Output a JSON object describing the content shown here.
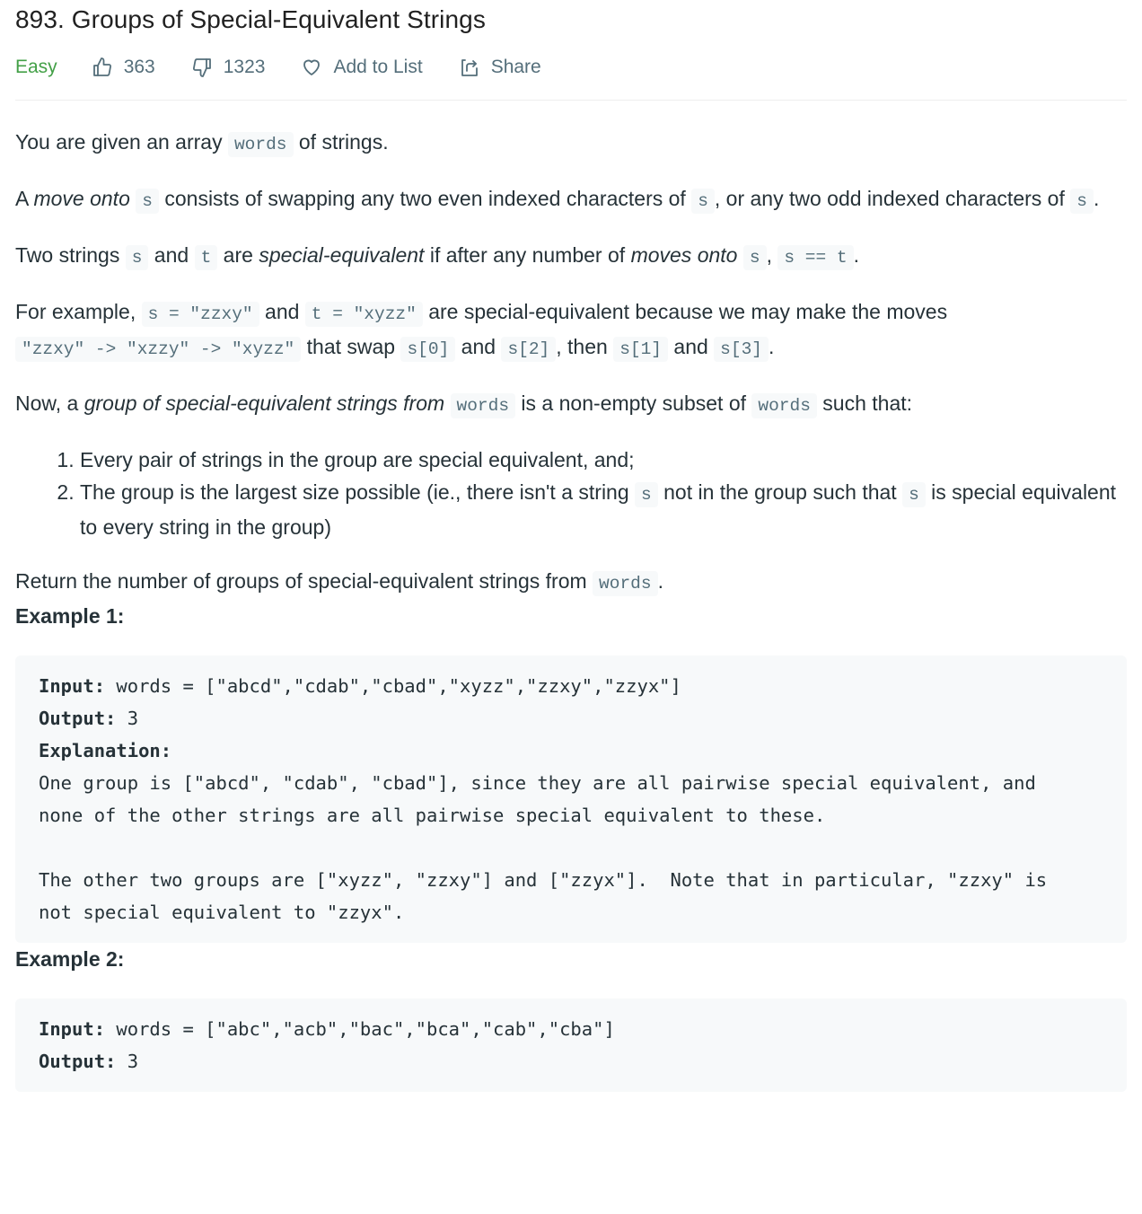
{
  "problem": {
    "title": "893. Groups of Special-Equivalent Strings",
    "difficulty": "Easy",
    "difficulty_color": "#43a047",
    "likes": "363",
    "dislikes": "1323",
    "add_to_list_label": "Add to List",
    "share_label": "Share",
    "icons": {
      "likes": "thumbs-up-icon",
      "dislikes": "thumbs-down-icon",
      "add_to_list": "heart-icon",
      "share": "share-icon"
    }
  },
  "description": {
    "p1": {
      "a": "You are given an array ",
      "code1": "words",
      "b": " of strings."
    },
    "p2": {
      "a": "A ",
      "em1": "move onto",
      "b": " ",
      "code1": "s",
      "c": " consists of swapping any two even indexed characters of ",
      "code2": "s",
      "d": ", or any two odd indexed characters of ",
      "code3": "s",
      "e": "."
    },
    "p3": {
      "a": "Two strings ",
      "code1": "s",
      "b": " and ",
      "code2": "t",
      "c": " are ",
      "em1": "special-equivalent",
      "d": " if after any number of ",
      "em2": "moves onto",
      "e": " ",
      "code3": "s",
      "f": ", ",
      "code4": "s == t",
      "g": "."
    },
    "p4": {
      "a": "For example, ",
      "code1": "s = \"zzxy\"",
      "b": " and ",
      "code2": "t = \"xyzz\"",
      "c": " are special-equivalent because we may make the moves ",
      "code3": "\"zzxy\" -> \"xzzy\" -> \"xyzz\"",
      "d": " that swap ",
      "code4": "s[0]",
      "e": " and ",
      "code5": "s[2]",
      "f": ", then ",
      "code6": "s[1]",
      "g": " and ",
      "code7": "s[3]",
      "h": "."
    },
    "p5": {
      "a": "Now, a ",
      "em1": "group of special-equivalent strings from",
      "b": " ",
      "code1": "words",
      "c": " is a non-empty subset of ",
      "code2": "words",
      "d": " such that:"
    },
    "list": [
      {
        "text": "Every pair of strings in the group are special equivalent, and;"
      },
      {
        "a": "The group is the largest size possible (ie., there isn't a string ",
        "code1": "s",
        "b": " not in the group such that ",
        "code2": "s",
        "c": " is special equivalent to every string in the group)"
      }
    ],
    "p6": {
      "a": "Return the number of groups of special-equivalent strings from ",
      "code1": "words",
      "b": "."
    }
  },
  "examples": [
    {
      "title": "Example 1:",
      "input_label": "Input:",
      "input": " words = [\"abcd\",\"cdab\",\"cbad\",\"xyzz\",\"zzxy\",\"zzyx\"]",
      "output_label": "Output:",
      "output": " 3",
      "explanation_label": "Explanation:",
      "explanation_lines": [
        "One group is [\"abcd\", \"cdab\", \"cbad\"], since they are all pairwise special equivalent, and",
        "none of the other strings are all pairwise special equivalent to these.",
        "",
        "The other two groups are [\"xyzz\", \"zzxy\"] and [\"zzyx\"].  Note that in particular, \"zzxy\" is",
        "not special equivalent to \"zzyx\"."
      ]
    },
    {
      "title": "Example 2:",
      "input_label": "Input:",
      "input": " words = [\"abc\",\"acb\",\"bac\",\"bca\",\"cab\",\"cba\"]",
      "output_label": "Output:",
      "output": " 3"
    }
  ]
}
